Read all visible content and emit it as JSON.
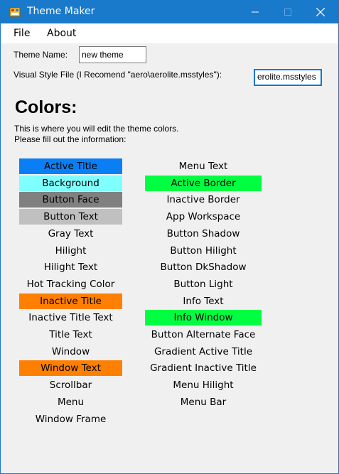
{
  "window": {
    "title": "Theme Maker",
    "colors": {
      "titlebar": "#1979ca",
      "client": "#f0f0f0"
    }
  },
  "menu": {
    "file": "File",
    "about": "About"
  },
  "form": {
    "theme_name_label": "Theme Name:",
    "theme_name_value": "new theme",
    "style_file_label": "Visual Style File (I Recomend \"aero\\aerolite.msstyles\"):",
    "style_file_value": "erolite.msstyles"
  },
  "colors_section": {
    "heading": "Colors:",
    "description_line1": "This is where you will edit the theme colors.",
    "description_line2": "Please fill out the information:"
  },
  "color_items_left": [
    {
      "label": "Active Title",
      "color": "#0a7ff5"
    },
    {
      "label": "Background",
      "color": "#80ffff"
    },
    {
      "label": "Button Face",
      "color": "#808080"
    },
    {
      "label": "Button Text",
      "color": "#c0c0c0"
    },
    {
      "label": "Gray Text",
      "color": ""
    },
    {
      "label": "Hilight",
      "color": ""
    },
    {
      "label": "Hilight Text",
      "color": ""
    },
    {
      "label": "Hot Tracking Color",
      "color": ""
    },
    {
      "label": "Inactive Title",
      "color": "#ff8000"
    },
    {
      "label": "Inactive Title Text",
      "color": ""
    },
    {
      "label": "Title Text",
      "color": ""
    },
    {
      "label": "Window",
      "color": ""
    },
    {
      "label": "Window Text",
      "color": "#ff8000"
    },
    {
      "label": "Scrollbar",
      "color": ""
    },
    {
      "label": "Menu",
      "color": ""
    },
    {
      "label": "Window Frame",
      "color": ""
    }
  ],
  "color_items_right": [
    {
      "label": "Menu Text",
      "color": ""
    },
    {
      "label": "Active Border",
      "color": "#00ff40"
    },
    {
      "label": "Inactive Border",
      "color": ""
    },
    {
      "label": "App Workspace",
      "color": ""
    },
    {
      "label": "Button Shadow",
      "color": ""
    },
    {
      "label": "Button Hilight",
      "color": ""
    },
    {
      "label": "Button DkShadow",
      "color": ""
    },
    {
      "label": "Button Light",
      "color": ""
    },
    {
      "label": "Info Text",
      "color": ""
    },
    {
      "label": "Info Window",
      "color": "#00ff40"
    },
    {
      "label": "Button Alternate Face",
      "color": ""
    },
    {
      "label": "Gradient Active Title",
      "color": ""
    },
    {
      "label": "Gradient Inactive Title",
      "color": ""
    },
    {
      "label": "Menu Hilight",
      "color": ""
    },
    {
      "label": "Menu Bar",
      "color": ""
    }
  ]
}
